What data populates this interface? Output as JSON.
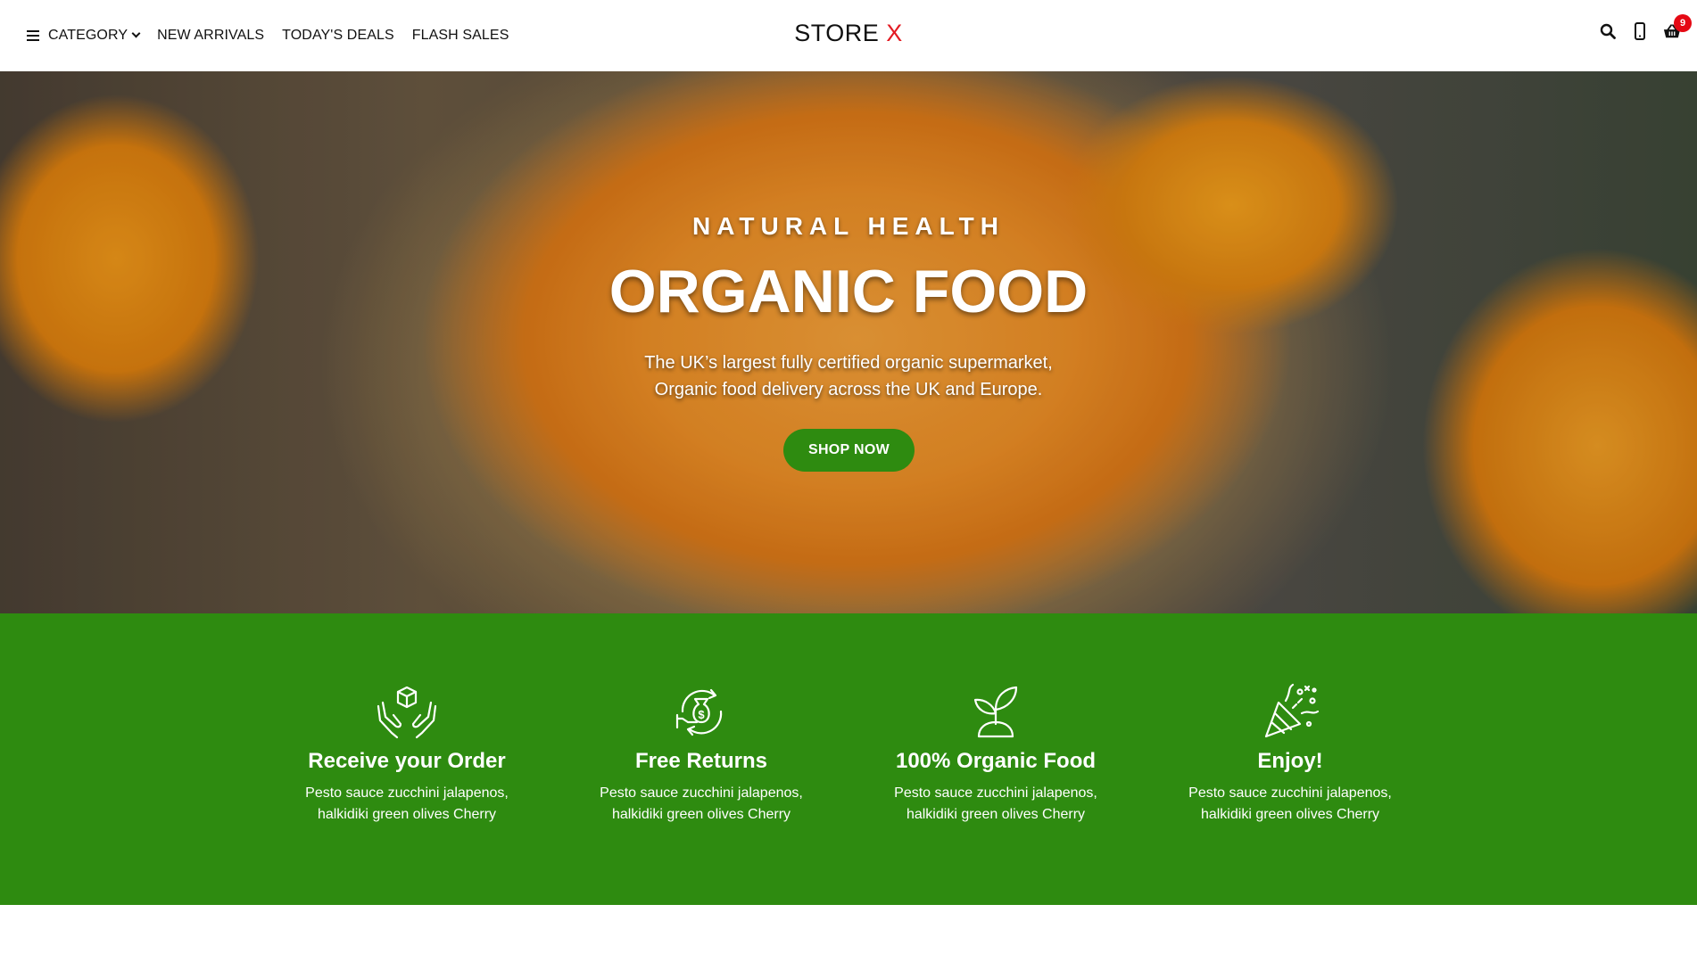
{
  "header": {
    "nav": [
      {
        "label": "CATEGORY"
      },
      {
        "label": "NEW ARRIVALS"
      },
      {
        "label": "TODAY'S DEALS"
      },
      {
        "label": "FLASH SALES"
      }
    ],
    "logo": {
      "text": "STORE",
      "accent": "X",
      "accent_color": "#e31b23"
    },
    "cart_count": "9",
    "icons": [
      "search-icon",
      "phone-icon",
      "basket-icon"
    ]
  },
  "hero": {
    "eyebrow": "NATURAL HEALTH",
    "title": "ORGANIC FOOD",
    "desc_line1": "The UK’s largest fully certified organic supermarket,",
    "desc_line2": "Organic food delivery across the UK and Europe.",
    "cta": "SHOP NOW",
    "cta_color": "#2e8b10"
  },
  "features": {
    "background": "#2e8b10",
    "items": [
      {
        "icon": "hands-box-icon",
        "title": "Receive your Order",
        "line1": "Pesto sauce zucchini jalapenos,",
        "line2": "halkidiki green olives Cherry"
      },
      {
        "icon": "money-return-icon",
        "title": "Free Returns",
        "line1": "Pesto sauce zucchini jalapenos,",
        "line2": "halkidiki green olives Cherry"
      },
      {
        "icon": "sprout-icon",
        "title": "100% Organic Food",
        "line1": "Pesto sauce zucchini jalapenos,",
        "line2": "halkidiki green olives Cherry"
      },
      {
        "icon": "party-popper-icon",
        "title": "Enjoy!",
        "line1": "Pesto sauce zucchini jalapenos,",
        "line2": "halkidiki green olives Cherry"
      }
    ]
  }
}
